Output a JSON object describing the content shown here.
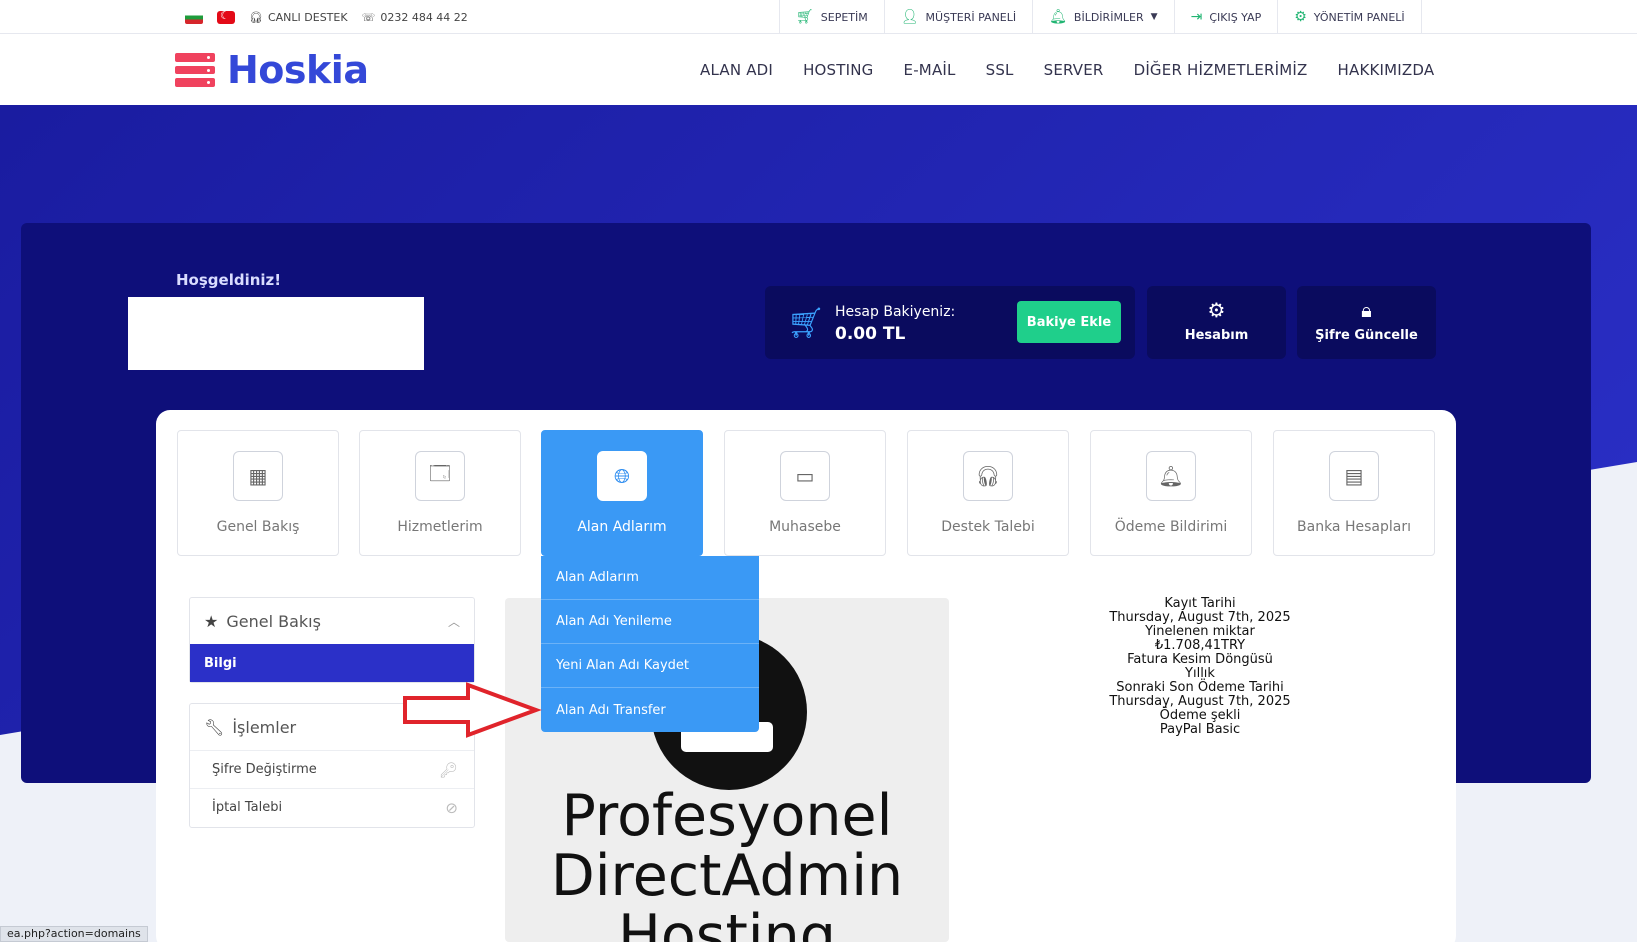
{
  "topbar": {
    "support_label": "CANLI DESTEK",
    "phone": "0232 484 44 22",
    "right": [
      {
        "label": "SEPETİM",
        "icon": "cart-icon"
      },
      {
        "label": "MÜŞTERİ PANELİ",
        "icon": "user-icon"
      },
      {
        "label": "BİLDİRİMLER",
        "icon": "bell-icon"
      },
      {
        "label": "ÇIKIŞ YAP",
        "icon": "logout-icon"
      },
      {
        "label": "YÖNETİM PANELİ",
        "icon": "gears-icon"
      }
    ]
  },
  "brand": {
    "name": "Hoskia",
    "color": "#3448d8",
    "mark_color": "#f0425e"
  },
  "nav": [
    "ALAN ADI",
    "HOSTING",
    "E-MAİL",
    "SSL",
    "SERVER",
    "DİĞER HİZMETLERİMİZ",
    "HAKKIMIZDA"
  ],
  "welcome": "Hoşgeldiniz!",
  "balance": {
    "label": "Hesap Bakiyeniz:",
    "value": "0.00 TL",
    "add_label": "Bakiye Ekle"
  },
  "quick": [
    {
      "label": "Hesabım",
      "icon": "gear-icon"
    },
    {
      "label": "Şifre Güncelle",
      "icon": "lock-icon"
    }
  ],
  "tiles": [
    {
      "label": "Genel Bakış",
      "icon": "dashboard-icon"
    },
    {
      "label": "Hizmetlerim",
      "icon": "browser-cursor-icon"
    },
    {
      "label": "Alan Adlarım",
      "icon": "globe-icon"
    },
    {
      "label": "Muhasebe",
      "icon": "money-icon"
    },
    {
      "label": "Destek Talebi",
      "icon": "headset-icon"
    },
    {
      "label": "Ödeme Bildirimi",
      "icon": "bell-icon"
    },
    {
      "label": "Banka Hesapları",
      "icon": "card-icon"
    }
  ],
  "dropdown": [
    "Alan Adlarım",
    "Alan Adı Yenileme",
    "Yeni Alan Adı Kaydet",
    "Alan Adı Transfer"
  ],
  "overview": {
    "title": "Genel Bakış",
    "active": "Bilgi"
  },
  "actions": {
    "title": "İşlemler",
    "items": [
      "Şifre Değiştirme",
      "İptal Talebi"
    ]
  },
  "product": {
    "line1": "Profesyonel",
    "line2": "DirectAdmin",
    "line3": "Hosting"
  },
  "info": [
    "Kayıt Tarihi",
    "Thursday, August 7th, 2025",
    "Yinelenen miktar",
    "₺1.708,41TRY",
    "Fatura Kesim Döngüsü",
    "Yıllık",
    "Sonraki Son Ödeme Tarihi",
    "Thursday, August 7th, 2025",
    "Ödeme şekli",
    "PayPal Basic"
  ],
  "status_url": "ea.php?action=domains",
  "colors": {
    "hero": "#2b30c8",
    "panel": "#0e0f7a",
    "accent_blue": "#3a99f5",
    "green": "#1fcf8b",
    "arrow": "#e0242b"
  }
}
